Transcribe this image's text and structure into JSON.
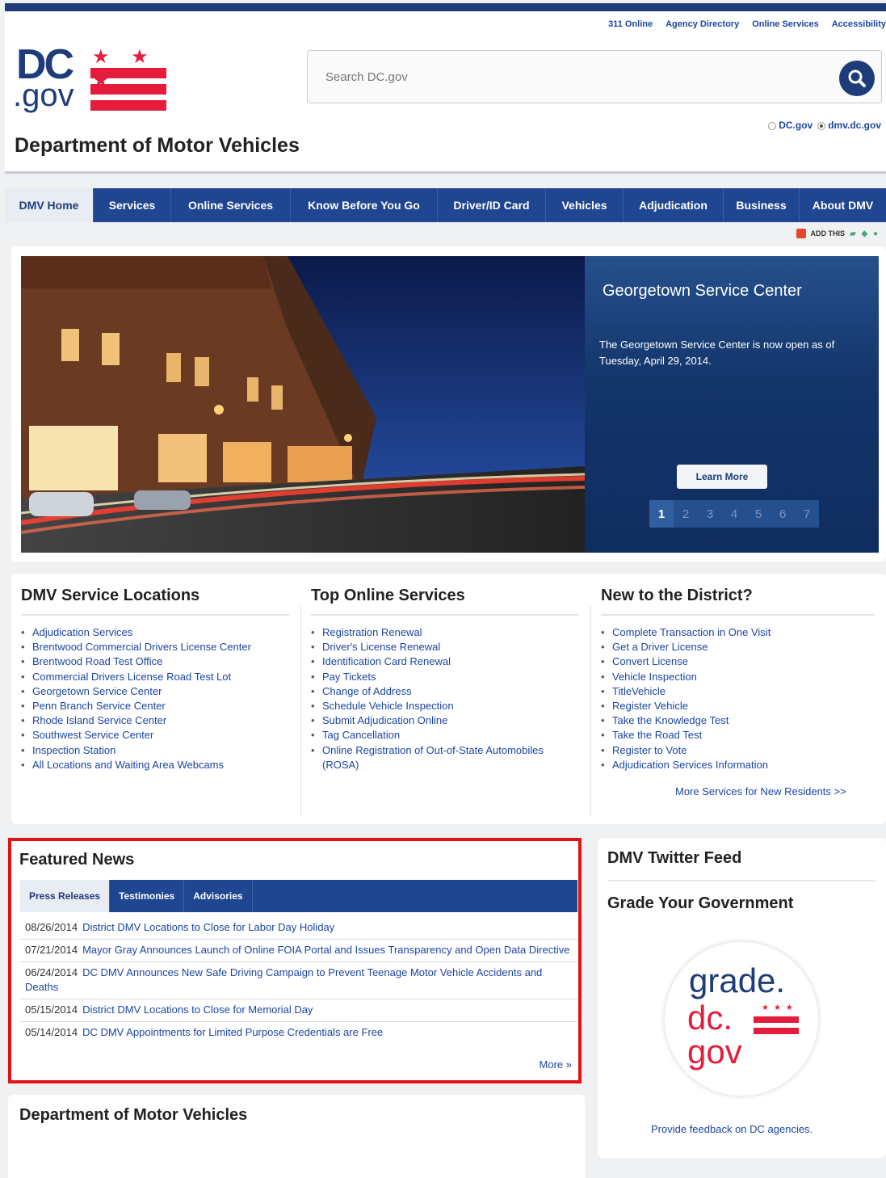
{
  "utility_links": [
    "311 Online",
    "Agency Directory",
    "Online Services",
    "Accessibility"
  ],
  "logo": {
    "dc": "DC",
    "gov": ".gov",
    "stars": "★ ★ ★"
  },
  "search": {
    "placeholder": "Search DC.gov"
  },
  "scope": {
    "opt1": "DC.gov",
    "opt2": "dmv.dc.gov",
    "selected": "dmv.dc.gov"
  },
  "page_title": "Department of Motor Vehicles",
  "nav": [
    "DMV Home",
    "Services",
    "Online Services",
    "Know Before You Go",
    "Driver/ID Card",
    "Vehicles",
    "Adjudication",
    "Business",
    "About DMV"
  ],
  "share": {
    "label": "ADD THIS"
  },
  "hero": {
    "title": "Georgetown Service Center",
    "text": "The Georgetown Service Center is now open as of Tuesday, April 29, 2014.",
    "button": "Learn More",
    "pages": [
      "1",
      "2",
      "3",
      "4",
      "5",
      "6",
      "7"
    ],
    "active_page": "1"
  },
  "locations": {
    "title": "DMV Service Locations",
    "items": [
      "Adjudication Services",
      "Brentwood Commercial Drivers License Center",
      "Brentwood Road Test Office",
      "Commercial Drivers License Road Test Lot",
      "Georgetown Service Center",
      "Penn Branch Service Center",
      "Rhode Island Service Center",
      "Southwest Service Center",
      "Inspection Station",
      "All Locations and Waiting Area Webcams"
    ]
  },
  "top_services": {
    "title": "Top Online Services",
    "items": [
      "Registration Renewal",
      "Driver's License Renewal",
      "Identification Card Renewal",
      "Pay Tickets",
      "Change of Address",
      "Schedule Vehicle Inspection",
      "Submit Adjudication Online",
      "Tag Cancellation",
      "Online Registration of Out-of-State Automobiles (ROSA)"
    ]
  },
  "new_district": {
    "title": "New to the District?",
    "items": [
      "Complete Transaction in One Visit",
      "Get a Driver License",
      "Convert License",
      "Vehicle Inspection",
      "TitleVehicle",
      "Register Vehicle",
      "Take the Knowledge Test",
      "Take the Road Test",
      "Register to Vote",
      "Adjudication Services Information"
    ],
    "more": "More Services for New Residents >>"
  },
  "news": {
    "title": "Featured News",
    "tabs": [
      "Press Releases",
      "Testimonies",
      "Advisories"
    ],
    "items": [
      {
        "date": "08/26/2014",
        "text": "District DMV Locations to Close for Labor Day Holiday"
      },
      {
        "date": "07/21/2014",
        "text": "Mayor Gray Announces Launch of Online FOIA Portal and Issues Transparency and Open Data Directive"
      },
      {
        "date": "06/24/2014",
        "text": "DC DMV Announces New Safe Driving Campaign to Prevent Teenage Motor Vehicle Accidents and Deaths"
      },
      {
        "date": "05/15/2014",
        "text": "District DMV Locations to Close for Memorial Day"
      },
      {
        "date": "05/14/2014",
        "text": "DC DMV Appointments for Limited Purpose Credentials are Free"
      }
    ],
    "more": "More »"
  },
  "dept_box": {
    "title": "Department of Motor Vehicles"
  },
  "side": {
    "twitter": "DMV Twitter Feed",
    "grade_title": "Grade Your Government",
    "grade_logo": {
      "l1": "grade.",
      "l2": "dc.",
      "l3": "gov"
    },
    "feedback": "Provide feedback on DC agencies."
  },
  "colors": {
    "navy": "#1f4690",
    "red": "#e31d3b",
    "highlight": "#e01414"
  }
}
